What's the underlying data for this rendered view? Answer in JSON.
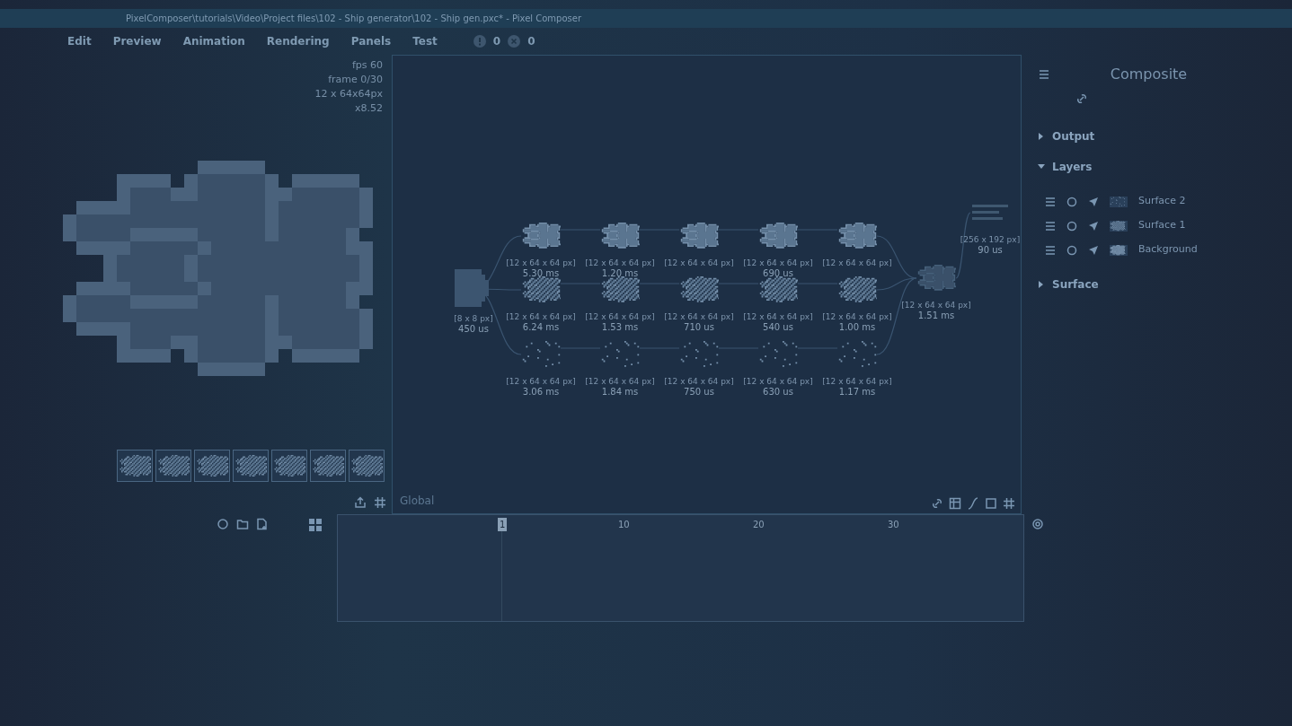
{
  "window": {
    "title": "PixelComposer\\tutorials\\Video\\Project files\\102 - Ship generator\\102 - Ship gen.pxc* - Pixel Composer"
  },
  "menu": [
    {
      "label": "Edit"
    },
    {
      "label": "Preview"
    },
    {
      "label": "Animation"
    },
    {
      "label": "Rendering"
    },
    {
      "label": "Panels"
    },
    {
      "label": "Test"
    }
  ],
  "status": {
    "warnings": "0",
    "errors": "0"
  },
  "preview": {
    "info": [
      "fps 60",
      "frame 0/30",
      "12 x 64x64px",
      "x8.52"
    ]
  },
  "graph": {
    "input": {
      "size": "[8 x 8 px]",
      "time": "450 us"
    },
    "rows": [
      {
        "nodes": [
          {
            "size": "[12 x 64 x 64 px]",
            "time": "5.30 ms"
          },
          {
            "size": "[12 x 64 x 64 px]",
            "time": "1.20 ms"
          },
          {
            "size": "[12 x 64 x 64 px]"
          },
          {
            "size": "[12 x 64 x 64 px]",
            "time": "690 us"
          },
          {
            "size": "[12 x 64 x 64 px]"
          }
        ]
      },
      {
        "nodes": [
          {
            "size": "[12 x 64 x 64 px]",
            "time": "6.24 ms"
          },
          {
            "size": "[12 x 64 x 64 px]",
            "time": "1.53 ms"
          },
          {
            "size": "[12 x 64 x 64 px]",
            "time": "710 us"
          },
          {
            "size": "[12 x 64 x 64 px]",
            "time": "540 us"
          },
          {
            "size": "[12 x 64 x 64 px]",
            "time": "1.00 ms"
          }
        ]
      },
      {
        "nodes": [
          {
            "size": "[12 x 64 x 64 px]",
            "time": "3.06 ms"
          },
          {
            "size": "[12 x 64 x 64 px]",
            "time": "1.84 ms"
          },
          {
            "size": "[12 x 64 x 64 px]",
            "time": "750 us"
          },
          {
            "size": "[12 x 64 x 64 px]",
            "time": "630 us"
          },
          {
            "size": "[12 x 64 x 64 px]",
            "time": "1.17 ms"
          }
        ]
      }
    ],
    "outputs": [
      {
        "size": "[12 x 64 x 64 px]",
        "time": "1.51 ms"
      },
      {
        "size": "[256 x 192 px]",
        "time": "90 us"
      }
    ],
    "context": "Global"
  },
  "inspector": {
    "title": "Composite",
    "sections": [
      {
        "label": "Output",
        "expanded": false
      },
      {
        "label": "Layers",
        "expanded": true,
        "layers": [
          {
            "name": "Surface 2"
          },
          {
            "name": "Surface 1"
          },
          {
            "name": "Background"
          }
        ]
      },
      {
        "label": "Surface",
        "expanded": false
      }
    ]
  },
  "timeline": {
    "ruler": [
      {
        "label": "1",
        "selected": true
      },
      {
        "label": "10",
        "selected": false
      },
      {
        "label": "20",
        "selected": false
      },
      {
        "label": "30",
        "selected": false
      }
    ]
  }
}
